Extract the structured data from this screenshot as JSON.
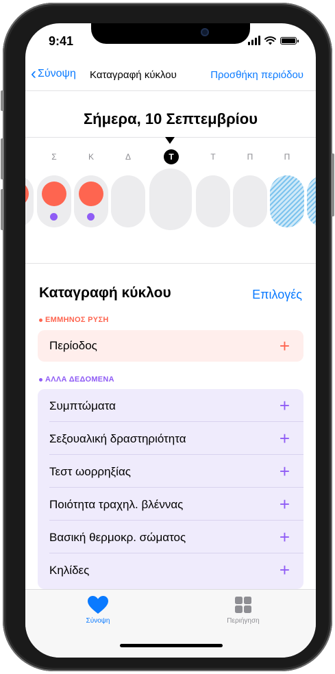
{
  "status": {
    "time": "9:41"
  },
  "nav": {
    "back_label": "Σύνοψη",
    "title": "Καταγραφή κύκλου",
    "action_label": "Προσθήκη περιόδου"
  },
  "calendar": {
    "date_title": "Σήμερα, 10 Σεπτεμβρίου",
    "weekdays": [
      "Σ",
      "Κ",
      "Δ",
      "Τ",
      "Τ",
      "Π",
      "Π"
    ],
    "today_index": 3
  },
  "log": {
    "title": "Καταγραφή κύκλου",
    "options_label": "Επιλογές",
    "menstruation": {
      "header": "ΕΜΜΗΝΟΣ ΡΥΣΗ",
      "items": [
        "Περίοδος"
      ]
    },
    "other_data": {
      "header": "ΑΛΛΑ ΔΕΔΟΜΕΝΑ",
      "items": [
        "Συμπτώματα",
        "Σεξουαλική δραστηριότητα",
        "Τεστ ωορρηξίας",
        "Ποιότητα τραχηλ. βλέννας",
        "Βασική θερμοκρ. σώματος",
        "Κηλίδες"
      ]
    },
    "plus_glyph": "+"
  },
  "tabbar": {
    "summary_label": "Σύνοψη",
    "browse_label": "Περιήγηση"
  },
  "colors": {
    "accent_blue": "#0a7aff",
    "period_red": "#fe6550",
    "other_purple": "#8f5cf5",
    "period_bg": "#ffeeec",
    "other_bg": "#efebfc"
  },
  "icons": {
    "summary": "heart-icon",
    "browse": "grid-icon",
    "back": "chevron-left-icon",
    "add": "plus-icon"
  }
}
